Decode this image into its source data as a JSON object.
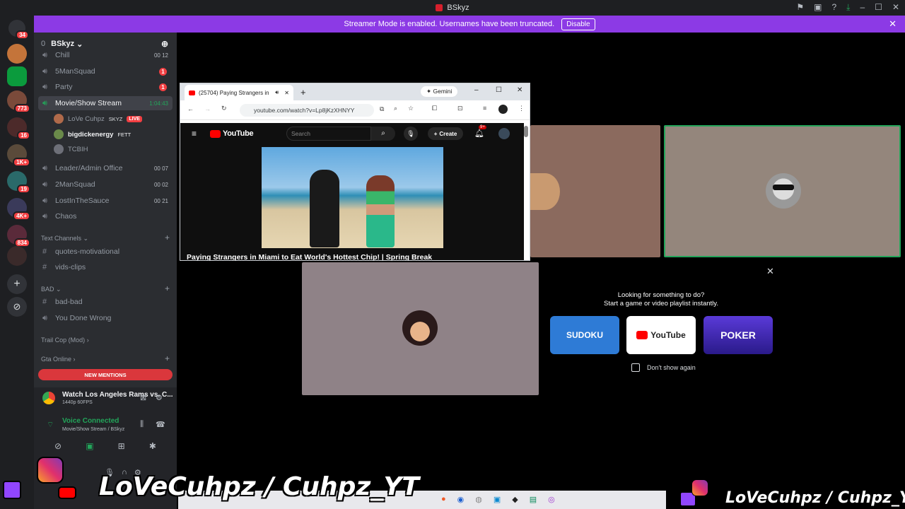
{
  "window": {
    "title": "BSkyz"
  },
  "banner": {
    "text": "Streamer Mode is enabled. Usernames have been truncated.",
    "disable_label": "Disable"
  },
  "rail": {
    "badges": [
      "34",
      "773",
      "16",
      "1K+",
      "19",
      "4K+",
      "834"
    ]
  },
  "server": {
    "name": "BSkyz",
    "boost_count": "0"
  },
  "channels": [
    {
      "name": "Chill",
      "count_left": "00",
      "count_right": "12"
    },
    {
      "name": "5ManSquad",
      "mention": "1"
    },
    {
      "name": "Party",
      "mention": "1"
    },
    {
      "name": "Movie/Show Stream",
      "timer": "1:04:43"
    },
    {
      "name": "Leader/Admin Office",
      "count_left": "00",
      "count_right": "07"
    },
    {
      "name": "2ManSquad",
      "count_left": "00",
      "count_right": "02"
    },
    {
      "name": "LostInTheSauce",
      "count_left": "00",
      "count_right": "21"
    },
    {
      "name": "Chaos"
    }
  ],
  "voice_users": [
    {
      "name": "LoVe Cuhpz",
      "tag": "SKYZ",
      "live": "LIVE"
    },
    {
      "name": "bigdickenergy",
      "tag": "FETT"
    },
    {
      "name": "TCBIH"
    }
  ],
  "categories": {
    "text_channels": "Text Channels",
    "bad": "BAD",
    "trail_cop": "Trail Cop (Mod)",
    "gta_online": "Gta Online"
  },
  "text_channels": [
    "quotes-motivational",
    "vids-clips"
  ],
  "bad_channels": [
    "bad-bad",
    "You Done Wrong"
  ],
  "new_mentions": "NEW MENTIONS",
  "activity_stream": {
    "title": "Watch Los Angeles Rams vs. C...",
    "quality": "1440p 60FPS"
  },
  "voice": {
    "status": "Voice Connected",
    "channel": "Movie/Show Stream / BSkyz"
  },
  "browser": {
    "tab_title": "(25704) Paying Strangers in",
    "gemini": "Gemini",
    "url": "youtube.com/watch?v=Lp8jKzXHNYY",
    "yt_logo": "YouTube",
    "search_placeholder": "Search",
    "create_label": "Create",
    "notifications": "9+",
    "video_title": "Paying Strangers in Miami to Eat World's Hottest Chip! | Spring Break"
  },
  "activity": {
    "prompt_line1": "Looking for something to do?",
    "prompt_line2": "Start a game or video playlist instantly.",
    "cards": [
      {
        "label": "SUDOKU",
        "color": "#2e7bd6"
      },
      {
        "label": "YouTube",
        "color": "#ffffff"
      },
      {
        "label": "POKER",
        "color": "#4a2bb8"
      }
    ],
    "dont_show": "Don't show again"
  },
  "overlay": {
    "watermark_left": "LoVeCuhpz / Cuhpz_YT",
    "watermark_right": "LoVeCuhpz / Cuhpz_YT"
  }
}
